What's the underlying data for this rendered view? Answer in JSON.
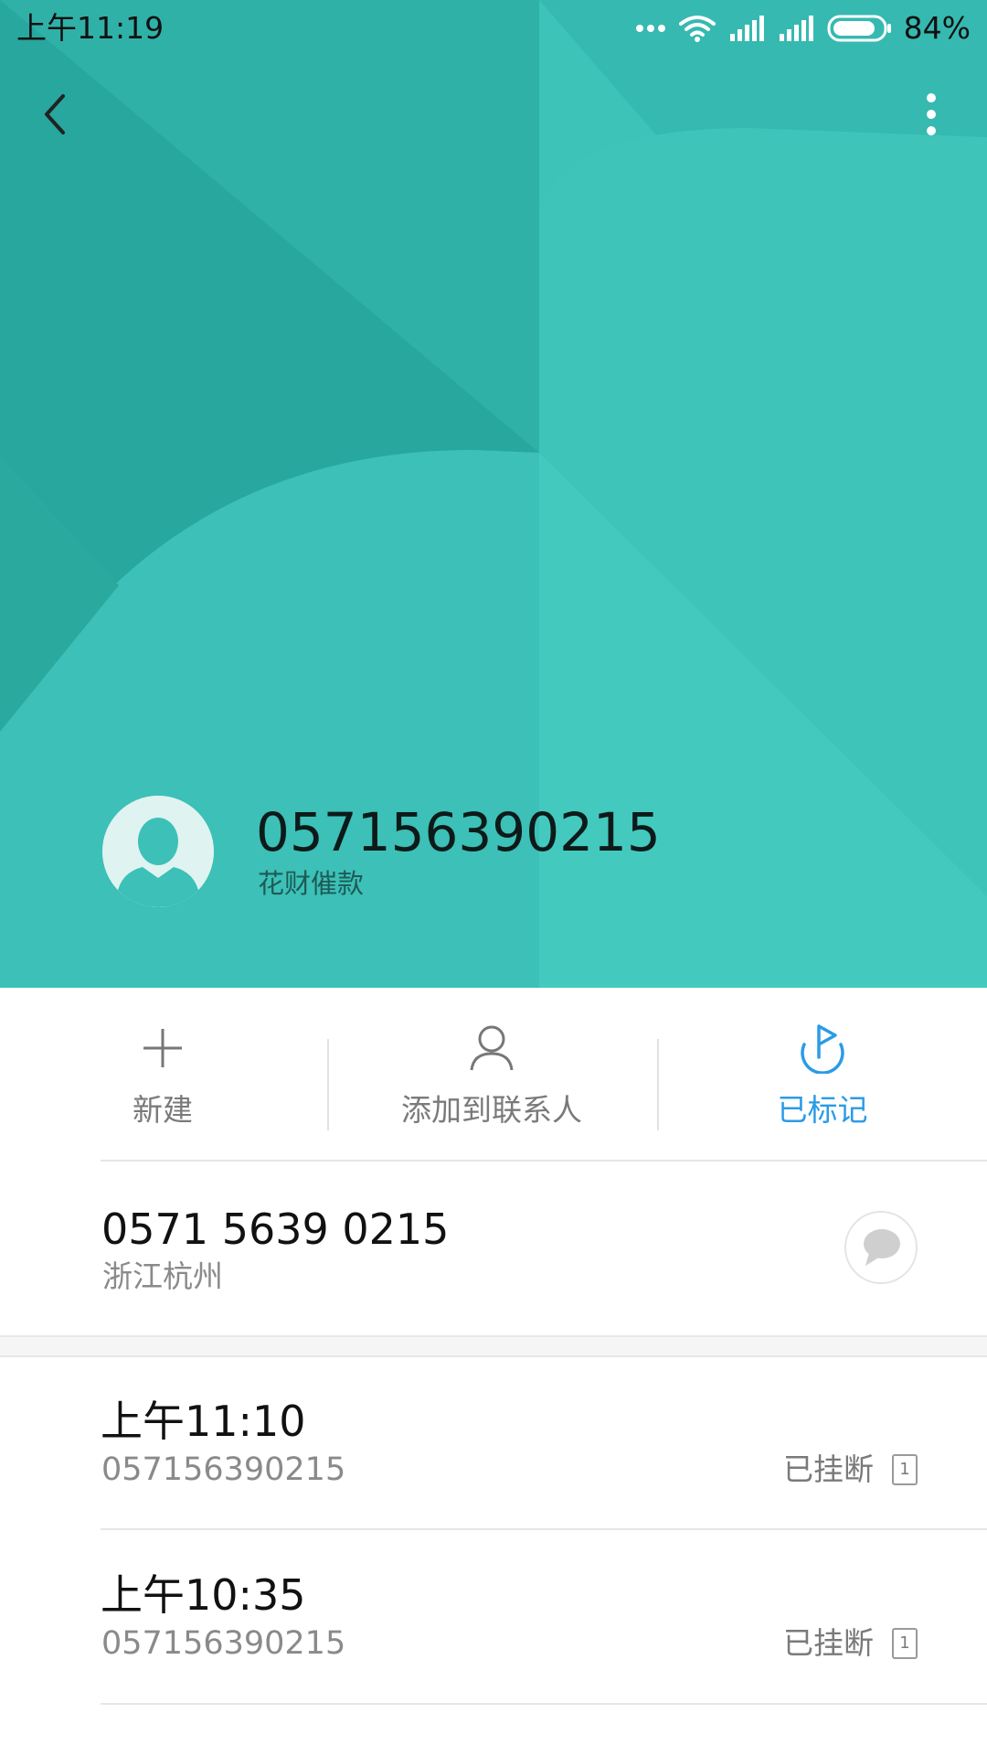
{
  "status_bar": {
    "time": "上午11:19",
    "battery_percent": "84%",
    "battery_level": 0.84,
    "icons": [
      "more-dots-icon",
      "wifi-icon",
      "signal-icon",
      "signal-icon",
      "battery-icon"
    ]
  },
  "toolbar": {
    "back_icon": "chevron-left-icon",
    "more_icon": "more-vertical-icon"
  },
  "caller": {
    "number": "057156390215",
    "tag": "花财催款",
    "avatar_icon": "person-silhouette-icon"
  },
  "actions": [
    {
      "label": "新建",
      "icon": "plus-icon"
    },
    {
      "label": "添加到联系人",
      "icon": "person-icon"
    },
    {
      "label": "已标记",
      "icon": "flag-icon"
    }
  ],
  "number_info": {
    "formatted_number": "0571 5639 0215",
    "location": "浙江杭州",
    "message_icon": "message-bubble-icon"
  },
  "call_log": [
    {
      "time": "上午11:10",
      "number": "057156390215",
      "status": "已挂断",
      "sim": "1"
    },
    {
      "time": "上午10:35",
      "number": "057156390215",
      "status": "已挂断",
      "sim": "1"
    }
  ],
  "colors": {
    "header_teal": "#37bcb3",
    "accent_blue": "#2b9be6"
  }
}
